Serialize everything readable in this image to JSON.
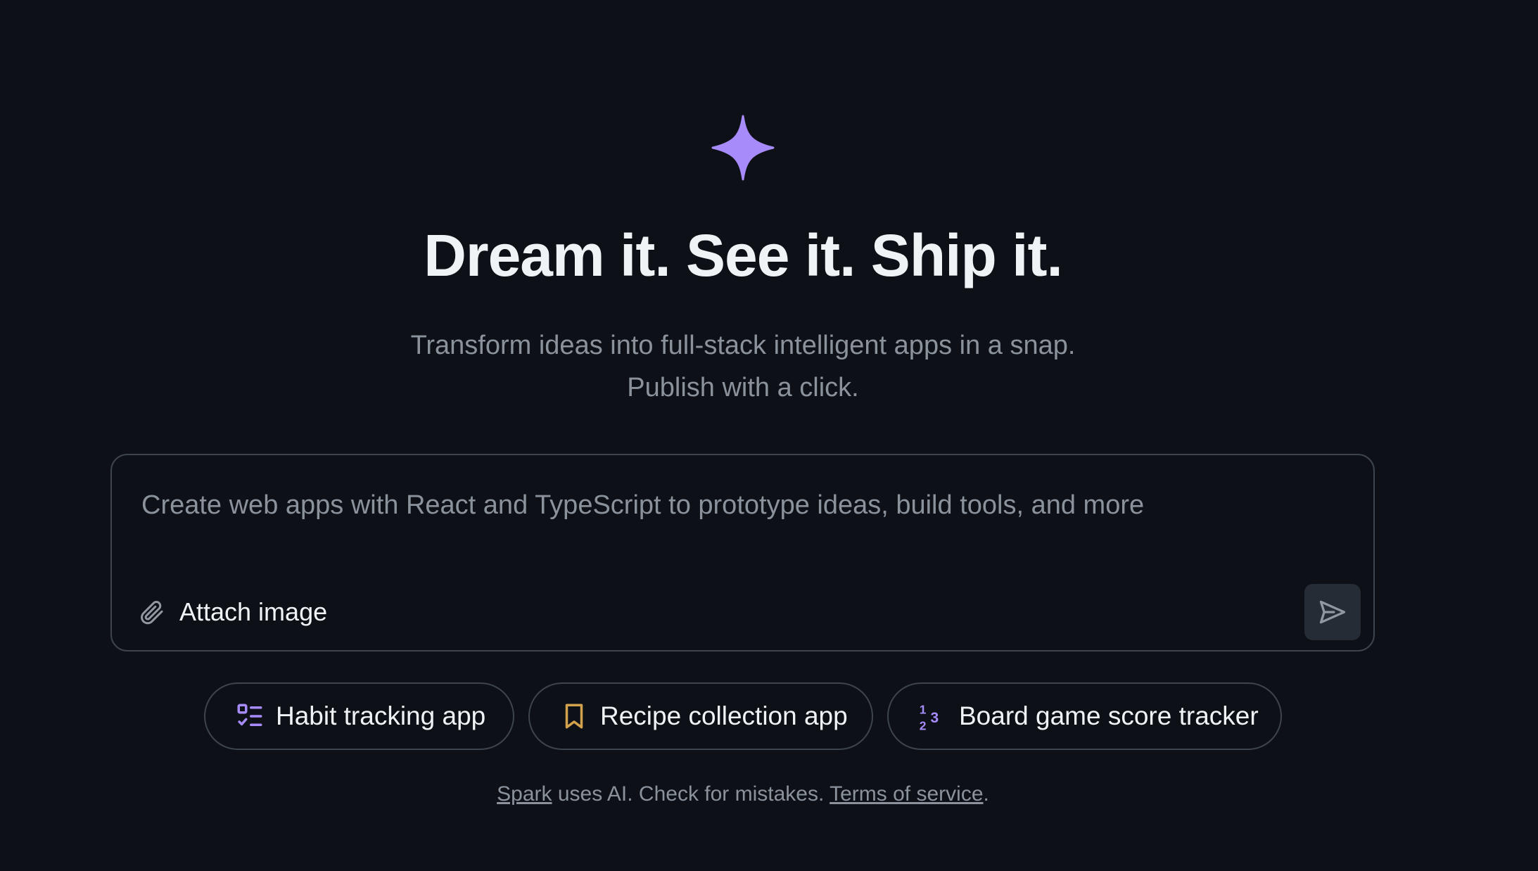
{
  "hero": {
    "headline": "Dream it. See it. Ship it.",
    "subline_1": "Transform ideas into full-stack intelligent apps in a snap.",
    "subline_2": "Publish with a click.",
    "logo_icon": "sparkle-icon",
    "logo_color": "#a78bfa"
  },
  "composer": {
    "placeholder": "Create web apps with React and TypeScript to prototype ideas, build tools, and more",
    "value": "",
    "attach_label": "Attach image",
    "attach_icon": "paperclip-icon",
    "send_icon": "send-icon"
  },
  "suggestions": [
    {
      "label": "Habit tracking app",
      "icon": "checklist-icon",
      "icon_color": "#a78bfa"
    },
    {
      "label": "Recipe collection app",
      "icon": "bookmark-icon",
      "icon_color": "#d4a24c"
    },
    {
      "label": "Board game score tracker",
      "icon": "numbers-icon",
      "icon_color": "#a78bfa"
    }
  ],
  "footer": {
    "spark_link": "Spark",
    "middle_text": " uses AI. Check for mistakes. ",
    "terms_link": "Terms of service",
    "end_text": "."
  },
  "colors": {
    "background": "#0d1117",
    "accent": "#a78bfa",
    "border": "#3d444d"
  }
}
